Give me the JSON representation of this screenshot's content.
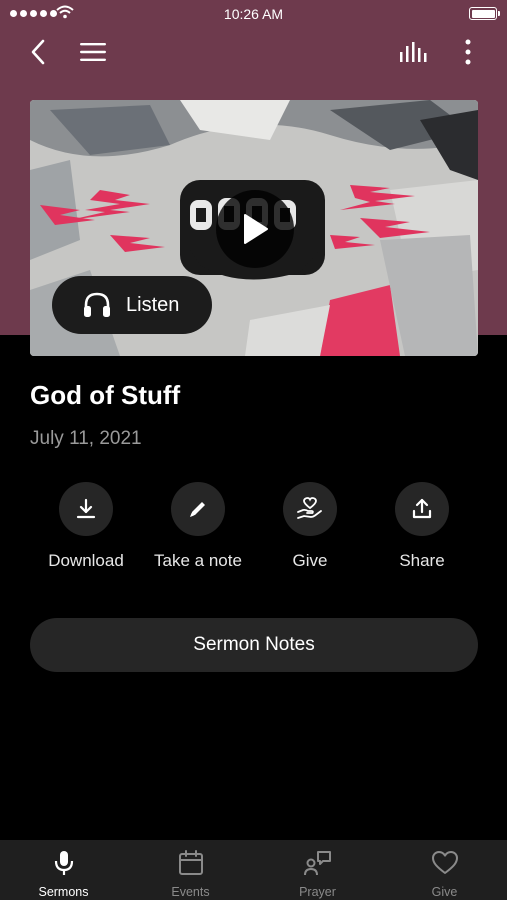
{
  "status_bar": {
    "time": "10:26 AM"
  },
  "sermon": {
    "title": "God of Stuff",
    "date": "July 11, 2021",
    "listen_label": "Listen"
  },
  "actions": [
    {
      "label": "Download",
      "icon": "download-icon"
    },
    {
      "label": "Take a note",
      "icon": "pencil-icon"
    },
    {
      "label": "Give",
      "icon": "heart-hand-icon"
    },
    {
      "label": "Share",
      "icon": "share-icon"
    }
  ],
  "notes_button": "Sermon Notes",
  "tabs": [
    {
      "label": "Sermons",
      "icon": "microphone-icon",
      "active": true
    },
    {
      "label": "Events",
      "icon": "calendar-icon",
      "active": false
    },
    {
      "label": "Prayer",
      "icon": "prayer-icon",
      "active": false
    },
    {
      "label": "Give",
      "icon": "heart-icon",
      "active": false
    }
  ],
  "colors": {
    "header_bg": "#6e3a4d",
    "background": "#000000",
    "button_bg": "#262626",
    "tabbar_bg": "#1f1f1f",
    "accent_pink": "#e0345e"
  }
}
